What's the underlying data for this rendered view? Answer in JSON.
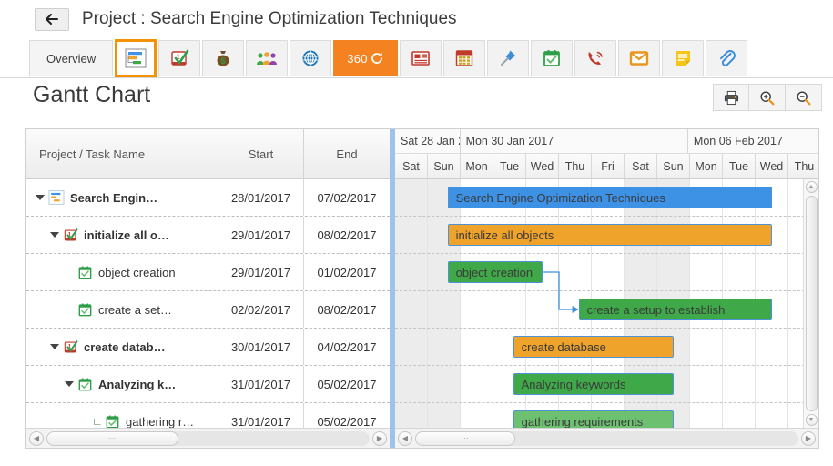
{
  "header": {
    "back_icon": "arrow-left-icon",
    "title": "Project : Search Engine Optimization Techniques"
  },
  "tabs": [
    {
      "label": "Overview",
      "name": "tab-overview",
      "type": "text",
      "active": false
    },
    {
      "label": "",
      "name": "tab-gantt-chart",
      "type": "icon",
      "icon": "gantt-chart-icon",
      "active": true
    },
    {
      "label": "",
      "name": "tab-tasks",
      "type": "icon",
      "icon": "task-checklist-icon",
      "active": false
    },
    {
      "label": "",
      "name": "tab-budget",
      "type": "icon",
      "icon": "money-bag-icon",
      "active": false
    },
    {
      "label": "",
      "name": "tab-team",
      "type": "icon",
      "icon": "team-people-icon",
      "active": false
    },
    {
      "label": "",
      "name": "tab-globe",
      "type": "icon",
      "icon": "globe-icon",
      "active": false
    },
    {
      "label": "360",
      "name": "tab-360-view",
      "type": "orange",
      "icon": "refresh-circle-icon",
      "active": false
    },
    {
      "label": "",
      "name": "tab-news",
      "type": "icon",
      "icon": "newspaper-icon",
      "active": false
    },
    {
      "label": "",
      "name": "tab-calendar",
      "type": "icon",
      "icon": "calendar-icon",
      "active": false
    },
    {
      "label": "",
      "name": "tab-pinned",
      "type": "icon",
      "icon": "pushpin-icon",
      "active": false
    },
    {
      "label": "",
      "name": "tab-milestones",
      "type": "icon",
      "icon": "calendar-check-icon",
      "active": false
    },
    {
      "label": "",
      "name": "tab-calls",
      "type": "icon",
      "icon": "phone-icon",
      "active": false
    },
    {
      "label": "",
      "name": "tab-mail",
      "type": "icon",
      "icon": "envelope-icon",
      "active": false
    },
    {
      "label": "",
      "name": "tab-notes",
      "type": "icon",
      "icon": "note-icon",
      "active": false
    },
    {
      "label": "",
      "name": "tab-attachments",
      "type": "icon",
      "icon": "paperclip-icon",
      "active": false
    }
  ],
  "page": {
    "title": "Gantt Chart",
    "actions": [
      {
        "name": "print-button",
        "icon": "printer-icon"
      },
      {
        "name": "zoom-in-button",
        "icon": "zoom-in-icon"
      },
      {
        "name": "zoom-out-button",
        "icon": "zoom-out-icon"
      }
    ]
  },
  "grid": {
    "columns": [
      "Project / Task Name",
      "Start",
      "End"
    ],
    "rows": [
      {
        "name": "Search Engin…",
        "full_name": "Search Engine Optimization Techniques",
        "start": "28/01/2017",
        "end": "07/02/2017",
        "indent": 0,
        "expanded": true,
        "bold": true,
        "icon": "gantt-chart-icon"
      },
      {
        "name": "initialize all o…",
        "full_name": "initialize all objects",
        "start": "29/01/2017",
        "end": "08/02/2017",
        "indent": 1,
        "expanded": true,
        "bold": true,
        "icon": "task-checklist-icon"
      },
      {
        "name": "object creation",
        "full_name": "object creation",
        "start": "29/01/2017",
        "end": "01/02/2017",
        "indent": 2,
        "expanded": null,
        "bold": false,
        "icon": "calendar-check-icon"
      },
      {
        "name": "create a set…",
        "full_name": "create a setup to establish",
        "start": "02/02/2017",
        "end": "08/02/2017",
        "indent": 2,
        "expanded": null,
        "bold": false,
        "icon": "calendar-check-icon"
      },
      {
        "name": "create datab…",
        "full_name": "create database",
        "start": "30/01/2017",
        "end": "04/02/2017",
        "indent": 1,
        "expanded": true,
        "bold": true,
        "icon": "task-checklist-icon"
      },
      {
        "name": "Analyzing k…",
        "full_name": "Analyzing keywords",
        "start": "31/01/2017",
        "end": "05/02/2017",
        "indent": 2,
        "expanded": true,
        "bold": true,
        "icon": "calendar-check-icon"
      },
      {
        "name": "gathering r…",
        "full_name": "gathering requirements",
        "start": "31/01/2017",
        "end": "05/02/2017",
        "indent": 3,
        "expanded": null,
        "bold": false,
        "icon": "calendar-check-icon",
        "child_marker": true
      }
    ]
  },
  "chart_data": {
    "type": "gantt",
    "title": "Gantt Chart",
    "weeks": [
      {
        "label": "Sat 28 Jan 2",
        "days": 2
      },
      {
        "label": "Mon 30 Jan 2017",
        "days": 7
      },
      {
        "label": "Mon 06 Feb 2017",
        "days": 4
      }
    ],
    "days": [
      "Sat",
      "Sun",
      "Mon",
      "Tue",
      "Wed",
      "Thu",
      "Fri",
      "Sat",
      "Sun",
      "Mon",
      "Tue",
      "Wed",
      "Thu"
    ],
    "weekend_indices": [
      0,
      1,
      7,
      8
    ],
    "day_width": 36,
    "tasks": [
      {
        "label": "Search Engine Optimization Techniques",
        "start_day": 1.6,
        "span_days": 9.9,
        "color": "#3d92e5",
        "border": "#4f93d6"
      },
      {
        "label": "initialize all objects",
        "start_day": 1.6,
        "span_days": 9.9,
        "color": "#f0a32a",
        "border": "#4f93d6"
      },
      {
        "label": "object creation",
        "start_day": 1.6,
        "span_days": 2.9,
        "color": "#3fa848",
        "border": "#4f93d6"
      },
      {
        "label": "create a setup to establish",
        "start_day": 5.6,
        "span_days": 5.9,
        "color": "#3fa848",
        "border": "#4f93d6"
      },
      {
        "label": "create database",
        "start_day": 3.6,
        "span_days": 4.9,
        "color": "#f0a32a",
        "border": "#4f93d6"
      },
      {
        "label": "Analyzing keywords",
        "start_day": 3.6,
        "span_days": 4.9,
        "color": "#3fa848",
        "border": "#4f93d6"
      },
      {
        "label": "gathering requirements",
        "start_day": 3.6,
        "span_days": 4.9,
        "color": "#6cc070",
        "border": "#4f93d6"
      }
    ],
    "dependencies": [
      {
        "from_task": 2,
        "to_task": 3,
        "type": "finish-to-start",
        "color": "#3d8ed8"
      }
    ]
  },
  "scrollbars": {
    "grid_h": {
      "name": "grid-horizontal-scrollbar",
      "thumb_left": 0,
      "thumb_width": 145,
      "grip": "⋯"
    },
    "timeline_h": {
      "name": "timeline-horizontal-scrollbar",
      "thumb_left": 0,
      "thumb_width": 110,
      "grip": "⋯"
    },
    "timeline_v": {
      "name": "timeline-vertical-scrollbar"
    },
    "left_arrow": "◀",
    "right_arrow": "▶",
    "up_arrow": "▲",
    "down_arrow": "▼"
  }
}
